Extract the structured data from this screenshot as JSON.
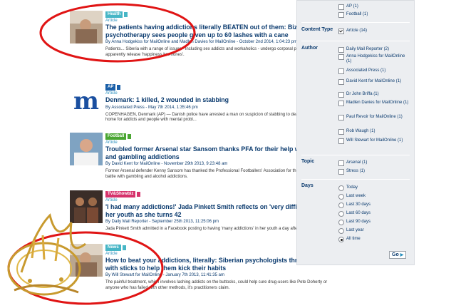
{
  "results": [
    {
      "tag": "Health",
      "tag_color": "#47b6c6",
      "type": "Article",
      "title": "The patients having addictions literally BEATEN out of them: Bizarre form of psychotherapy sees people given up to 60 lashes with a cane",
      "byline": "By Anna Hodgekiss for MailOnline and Madlen Davies for MailOnline - October 2nd 2014, 1:04:23 pm",
      "snippet": "Patients... Siberia with a range of issues - including sex addicts and workaholics - undergo corporal punishment to apparently release 'happiness hormones'."
    },
    {
      "tag": "AP",
      "tag_color": "#1a5fa8",
      "type": "Article",
      "title": "Denmark: 1 killed, 2 wounded in stabbing",
      "byline": "By Associated Press - May 7th 2014, 1:35:46 pm",
      "snippet": "COPENHAGEN, Denmark (AP) — Danish police have arrested a man on suspicion of stabbing to death an employee at a home for addicts and people with mental probl..."
    },
    {
      "tag": "Football",
      "tag_color": "#4aa632",
      "type": "Article",
      "title": "Troubled former Arsenal star Sansom thanks PFA for their help with alcohol and gambling addictions",
      "byline": "By David Kent for MailOnline - November 29th 2013, 9:23:48 am",
      "snippet": "Former Arsenal defender Kenny Sansom has thanked the Professional Footballers' Association for their help in his ongoing battle with gambling and alcohol addictions."
    },
    {
      "tag": "TV&Showbiz",
      "tag_color": "#d6336c",
      "type": "Article",
      "title": "'I had many addictions!' Jada Pinkett Smith reflects on 'very difficult time' in her youth as she turns 42",
      "byline": "By Daily Mail Reporter - September 25th 2013, 11:25:06 pm",
      "snippet": "Jada Pinkett Smith admitted in a Facebook posting to having 'many addictions' in her youth a day after turning 42"
    },
    {
      "tag": "News",
      "tag_color": "#47b6c6",
      "type": "Article",
      "title": "How to beat your addictions, literally: Siberian psychologists thrash patients with sticks to help them kick their habits",
      "byline": "By Will Stewart for MailOnline - January 7th 2013, 11:41:35 am",
      "snippet": "The painful treatment, which involves lashing addicts on the buttocks, could help cure drug-users like Pete Doherty or anyone who has failed with other methods, it's practitioners claim."
    }
  ],
  "sidebar": {
    "top_opts": [
      "AP (1)",
      "Football (1)"
    ],
    "content_type": {
      "label": "Content Type",
      "opts": [
        "Article (14)"
      ]
    },
    "author": {
      "label": "Author",
      "opts": [
        "Daily Mail Reporter (2)",
        "Anna Hodgekiss for MailOnline (1)",
        "Associated Press (1)",
        "David Kent for MailOnline (1)",
        "Dr John Briffa (1)",
        "Madlen Davies for MailOnline (1)",
        "Paul Revoir for MailOnline (1)",
        "Rob Waugh (1)",
        "Will Stewart for MailOnline (1)"
      ]
    },
    "topic": {
      "label": "Topic",
      "opts": [
        "Arsenal (1)",
        "Stress (1)"
      ]
    },
    "days": {
      "label": "Days",
      "opts": [
        "Today",
        "Last week",
        "Last 30 days",
        "Last 60 days",
        "Last 90 days",
        "Last year",
        "All time"
      ],
      "selected": 6
    },
    "go_label": "Go"
  }
}
